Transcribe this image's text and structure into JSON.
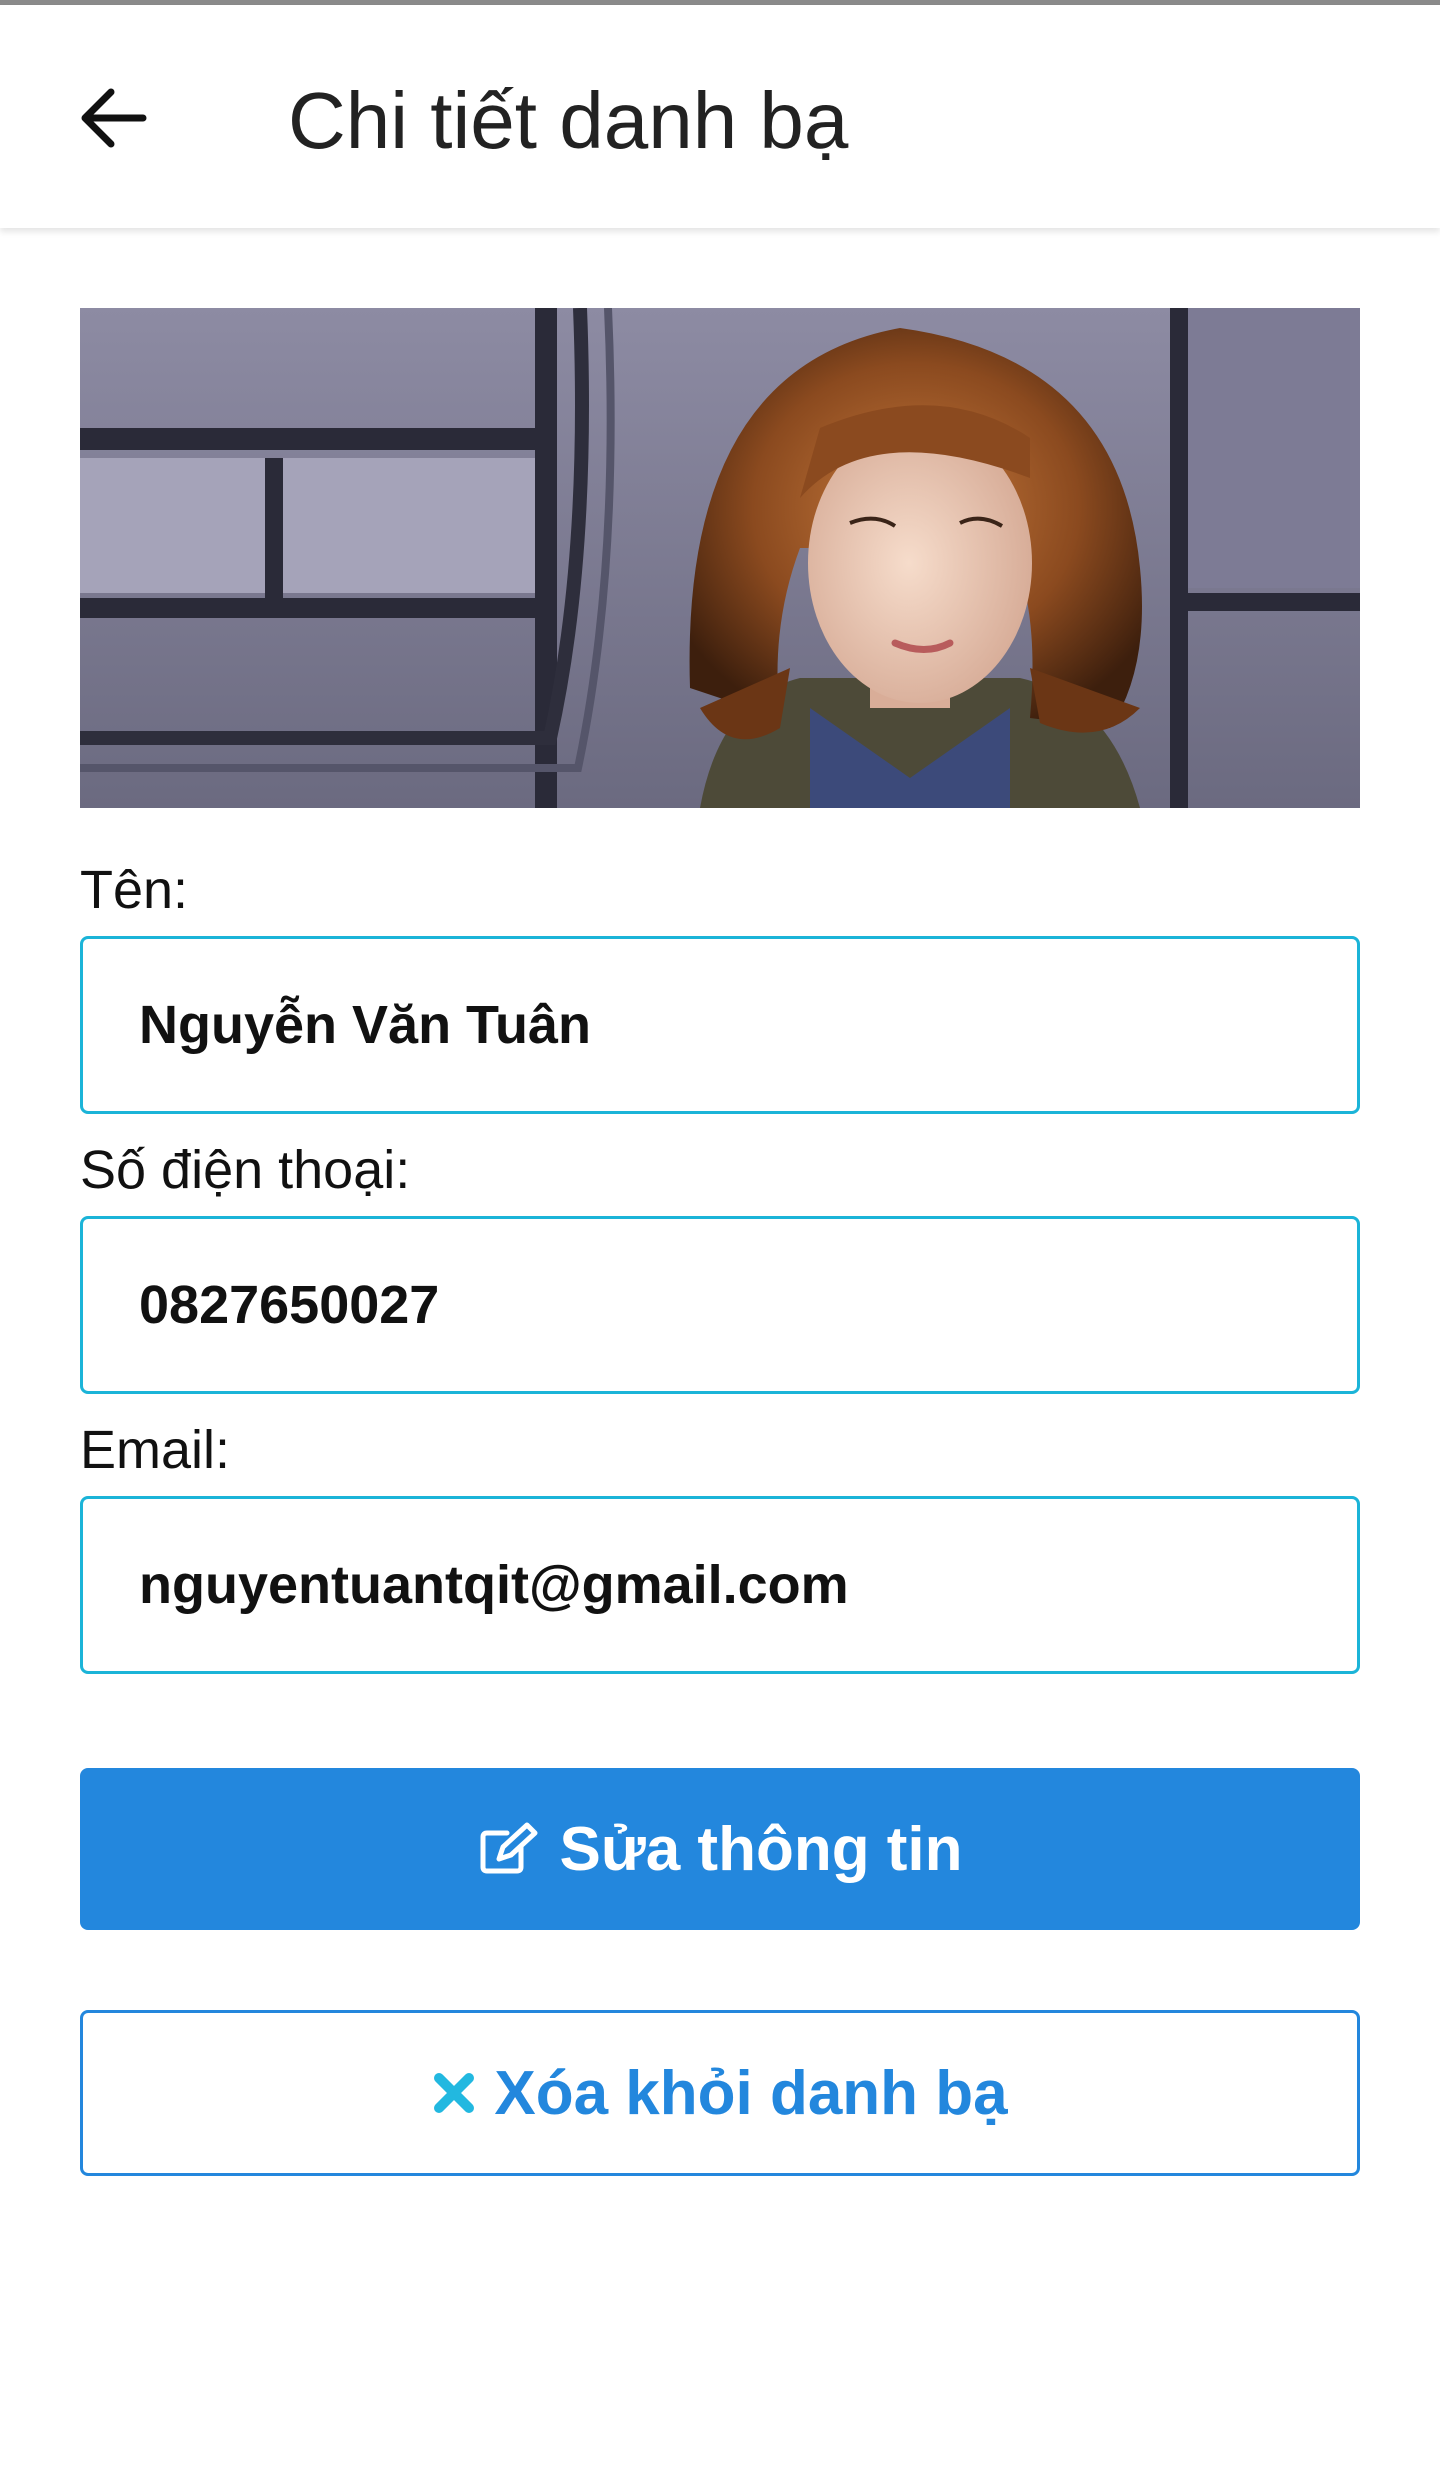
{
  "app_bar": {
    "title": "Chi tiết danh bạ",
    "back_icon": "arrow-left-icon"
  },
  "photo": {
    "icon": "contact-photo"
  },
  "form": {
    "name_label": "Tên:",
    "name_value": "Nguyễn Văn Tuân",
    "phone_label": "Số điện thoại:",
    "phone_value": "0827650027",
    "email_label": "Email:",
    "email_value": "nguyentuantqit@gmail.com"
  },
  "actions": {
    "edit_label": "Sửa thông tin",
    "edit_icon": "edit-icon",
    "delete_label": "Xóa khỏi danh bạ",
    "delete_icon": "close-icon"
  },
  "colors": {
    "primary": "#2387dd",
    "input_border": "#1bb4d8",
    "delete_icon": "#22b8e0"
  }
}
